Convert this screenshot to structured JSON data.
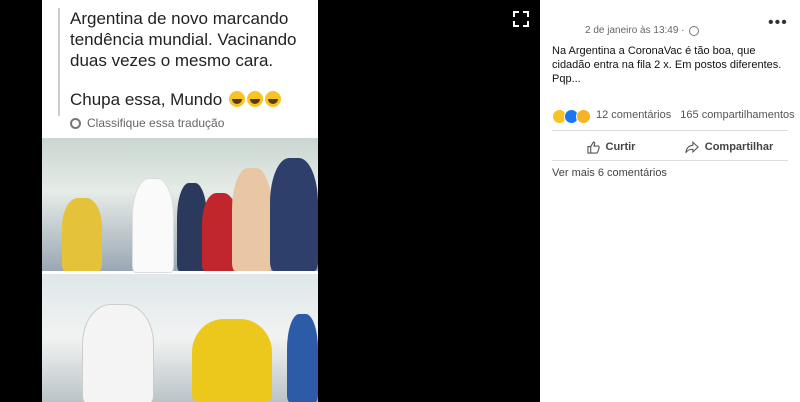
{
  "meme": {
    "text1": "Argentina de novo marcando tendência mundial. Vacinando duas vezes o mesmo cara.",
    "text2": "Chupa essa, Mundo",
    "translate": "Classifique essa tradução"
  },
  "post": {
    "timestamp": "2 de janeiro às 13:49 ·",
    "caption": "Na Argentina a CoronaVac é tão boa, que cidadão entra na fila 2 x. Em postos diferentes. Pqp...",
    "comments": "12 comentários",
    "shares": "165 compartilhamentos",
    "like_label": "Curtir",
    "share_label": "Compartilhar",
    "more_comments": "Ver mais 6 comentários"
  },
  "icons": {
    "expand": "expand-icon",
    "options": "more-options-icon",
    "like": "thumbs-up-icon",
    "share": "share-arrow-icon"
  }
}
